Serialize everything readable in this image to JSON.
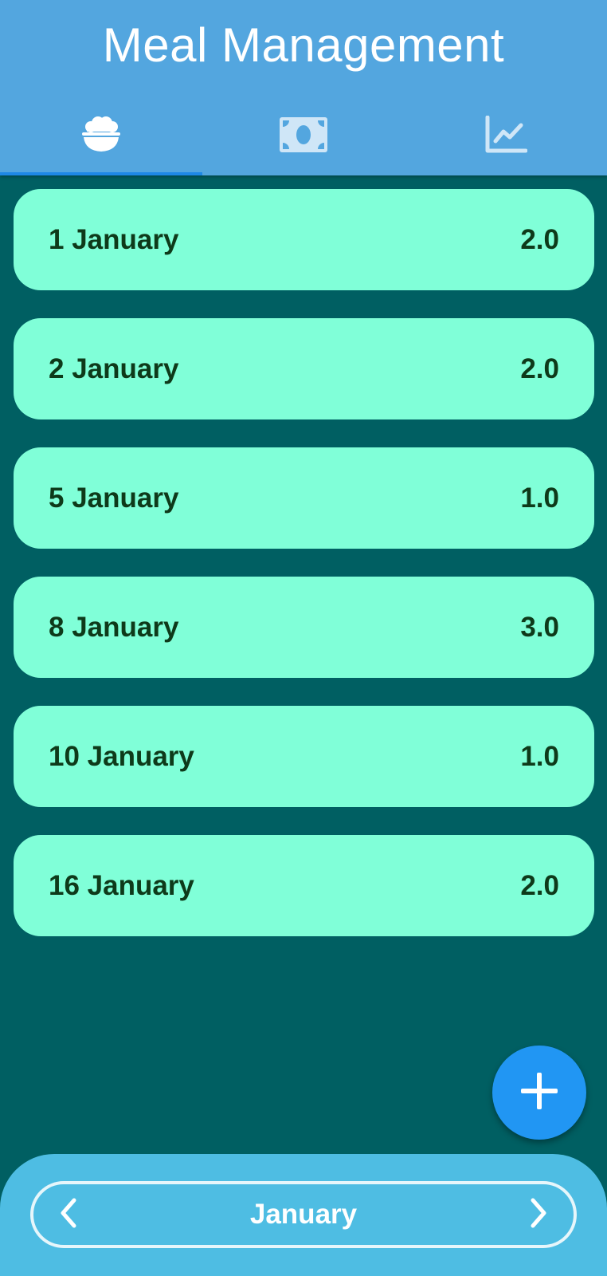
{
  "app": {
    "title": "Meal Management"
  },
  "tabs": [
    {
      "icon": "rice-bowl-icon",
      "active": true
    },
    {
      "icon": "money-icon",
      "active": false
    },
    {
      "icon": "chart-icon",
      "active": false
    }
  ],
  "meals": [
    {
      "date": "1 January",
      "count": "2.0"
    },
    {
      "date": "2 January",
      "count": "2.0"
    },
    {
      "date": "5 January",
      "count": "1.0"
    },
    {
      "date": "8 January",
      "count": "3.0"
    },
    {
      "date": "10 January",
      "count": "1.0"
    },
    {
      "date": "16 January",
      "count": "2.0"
    }
  ],
  "fab": {
    "icon": "plus-icon"
  },
  "month_selector": {
    "month": "January",
    "prev_icon": "chevron-left-icon",
    "next_icon": "chevron-right-icon"
  },
  "colors": {
    "appbar": "#53a6df",
    "background": "#005f62",
    "card": "#80ffd8",
    "card_text": "#0e3a1a",
    "fab": "#2196f3",
    "bottom_bar": "#4ebde3",
    "tab_indicator": "#1e88e5"
  }
}
